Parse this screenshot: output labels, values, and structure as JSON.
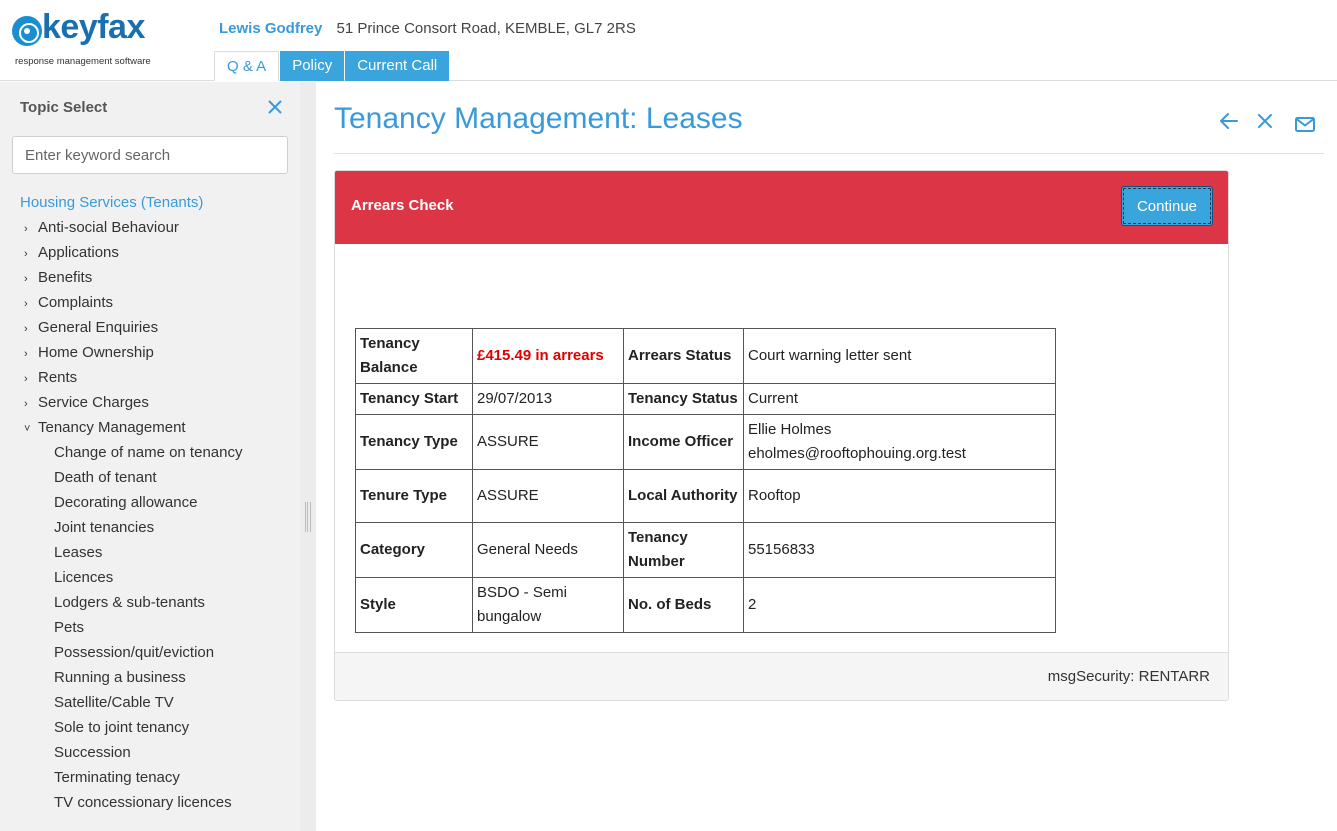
{
  "brand": {
    "name": "keyfax",
    "tagline": "response management software"
  },
  "caller": {
    "name": "Lewis Godfrey",
    "address": "51 Prince Consort Road, KEMBLE, GL7 2RS"
  },
  "tabs": [
    {
      "label": "Q & A",
      "active": true
    },
    {
      "label": "Policy",
      "active": false
    },
    {
      "label": "Current Call",
      "active": false
    }
  ],
  "sidebar": {
    "title": "Topic Select",
    "search_placeholder": "Enter keyword search",
    "root": "Housing Services (Tenants)",
    "categories": [
      "Anti-social Behaviour",
      "Applications",
      "Benefits",
      "Complaints",
      "General Enquiries",
      "Home Ownership",
      "Rents",
      "Service Charges",
      "Tenancy Management"
    ],
    "subitems": [
      "Change of name on tenancy",
      "Death of tenant",
      "Decorating allowance",
      "Joint tenancies",
      "Leases",
      "Licences",
      "Lodgers & sub-tenants",
      "Pets",
      "Possession/quit/eviction",
      "Running a business",
      "Satellite/Cable TV",
      "Sole to joint tenancy",
      "Succession",
      "Terminating tenacy",
      "TV concessionary licences"
    ]
  },
  "main": {
    "title": "Tenancy Management: Leases",
    "card": {
      "header_title": "Arrears Check",
      "continue_label": "Continue",
      "footer_text": "msgSecurity: RENTARR",
      "table": {
        "tenancy_balance_label": "Tenancy Balance",
        "tenancy_balance_value": "£415.49 in arrears",
        "arrears_status_label": "Arrears Status",
        "arrears_status_value": "Court warning letter sent",
        "tenancy_start_label": "Tenancy Start",
        "tenancy_start_value": "29/07/2013",
        "tenancy_status_label": "Tenancy Status",
        "tenancy_status_value": "Current",
        "tenancy_type_label": "Tenancy Type",
        "tenancy_type_value": "ASSURE",
        "income_officer_label": "Income Officer",
        "income_officer_name": "Ellie Holmes",
        "income_officer_email": "eholmes@rooftophouing.org.test",
        "tenure_type_label": "Tenure Type",
        "tenure_type_value": "ASSURE",
        "local_authority_label": "Local Authority",
        "local_authority_value": "Rooftop",
        "category_label": "Category",
        "category_value": "General Needs",
        "tenancy_number_label": "Tenancy Number",
        "tenancy_number_value": "55156833",
        "style_label": "Style",
        "style_value": "BSDO - Semi bungalow",
        "beds_label": "No. of Beds",
        "beds_value": "2"
      }
    }
  },
  "colors": {
    "accent": "#3a9ad9",
    "tab_bg": "#3aa5dc",
    "alert_header": "#dc3545",
    "arrears_text": "#e00000"
  },
  "icons": {
    "back": "arrow-left-icon",
    "close": "close-icon",
    "mail": "mail-icon"
  }
}
